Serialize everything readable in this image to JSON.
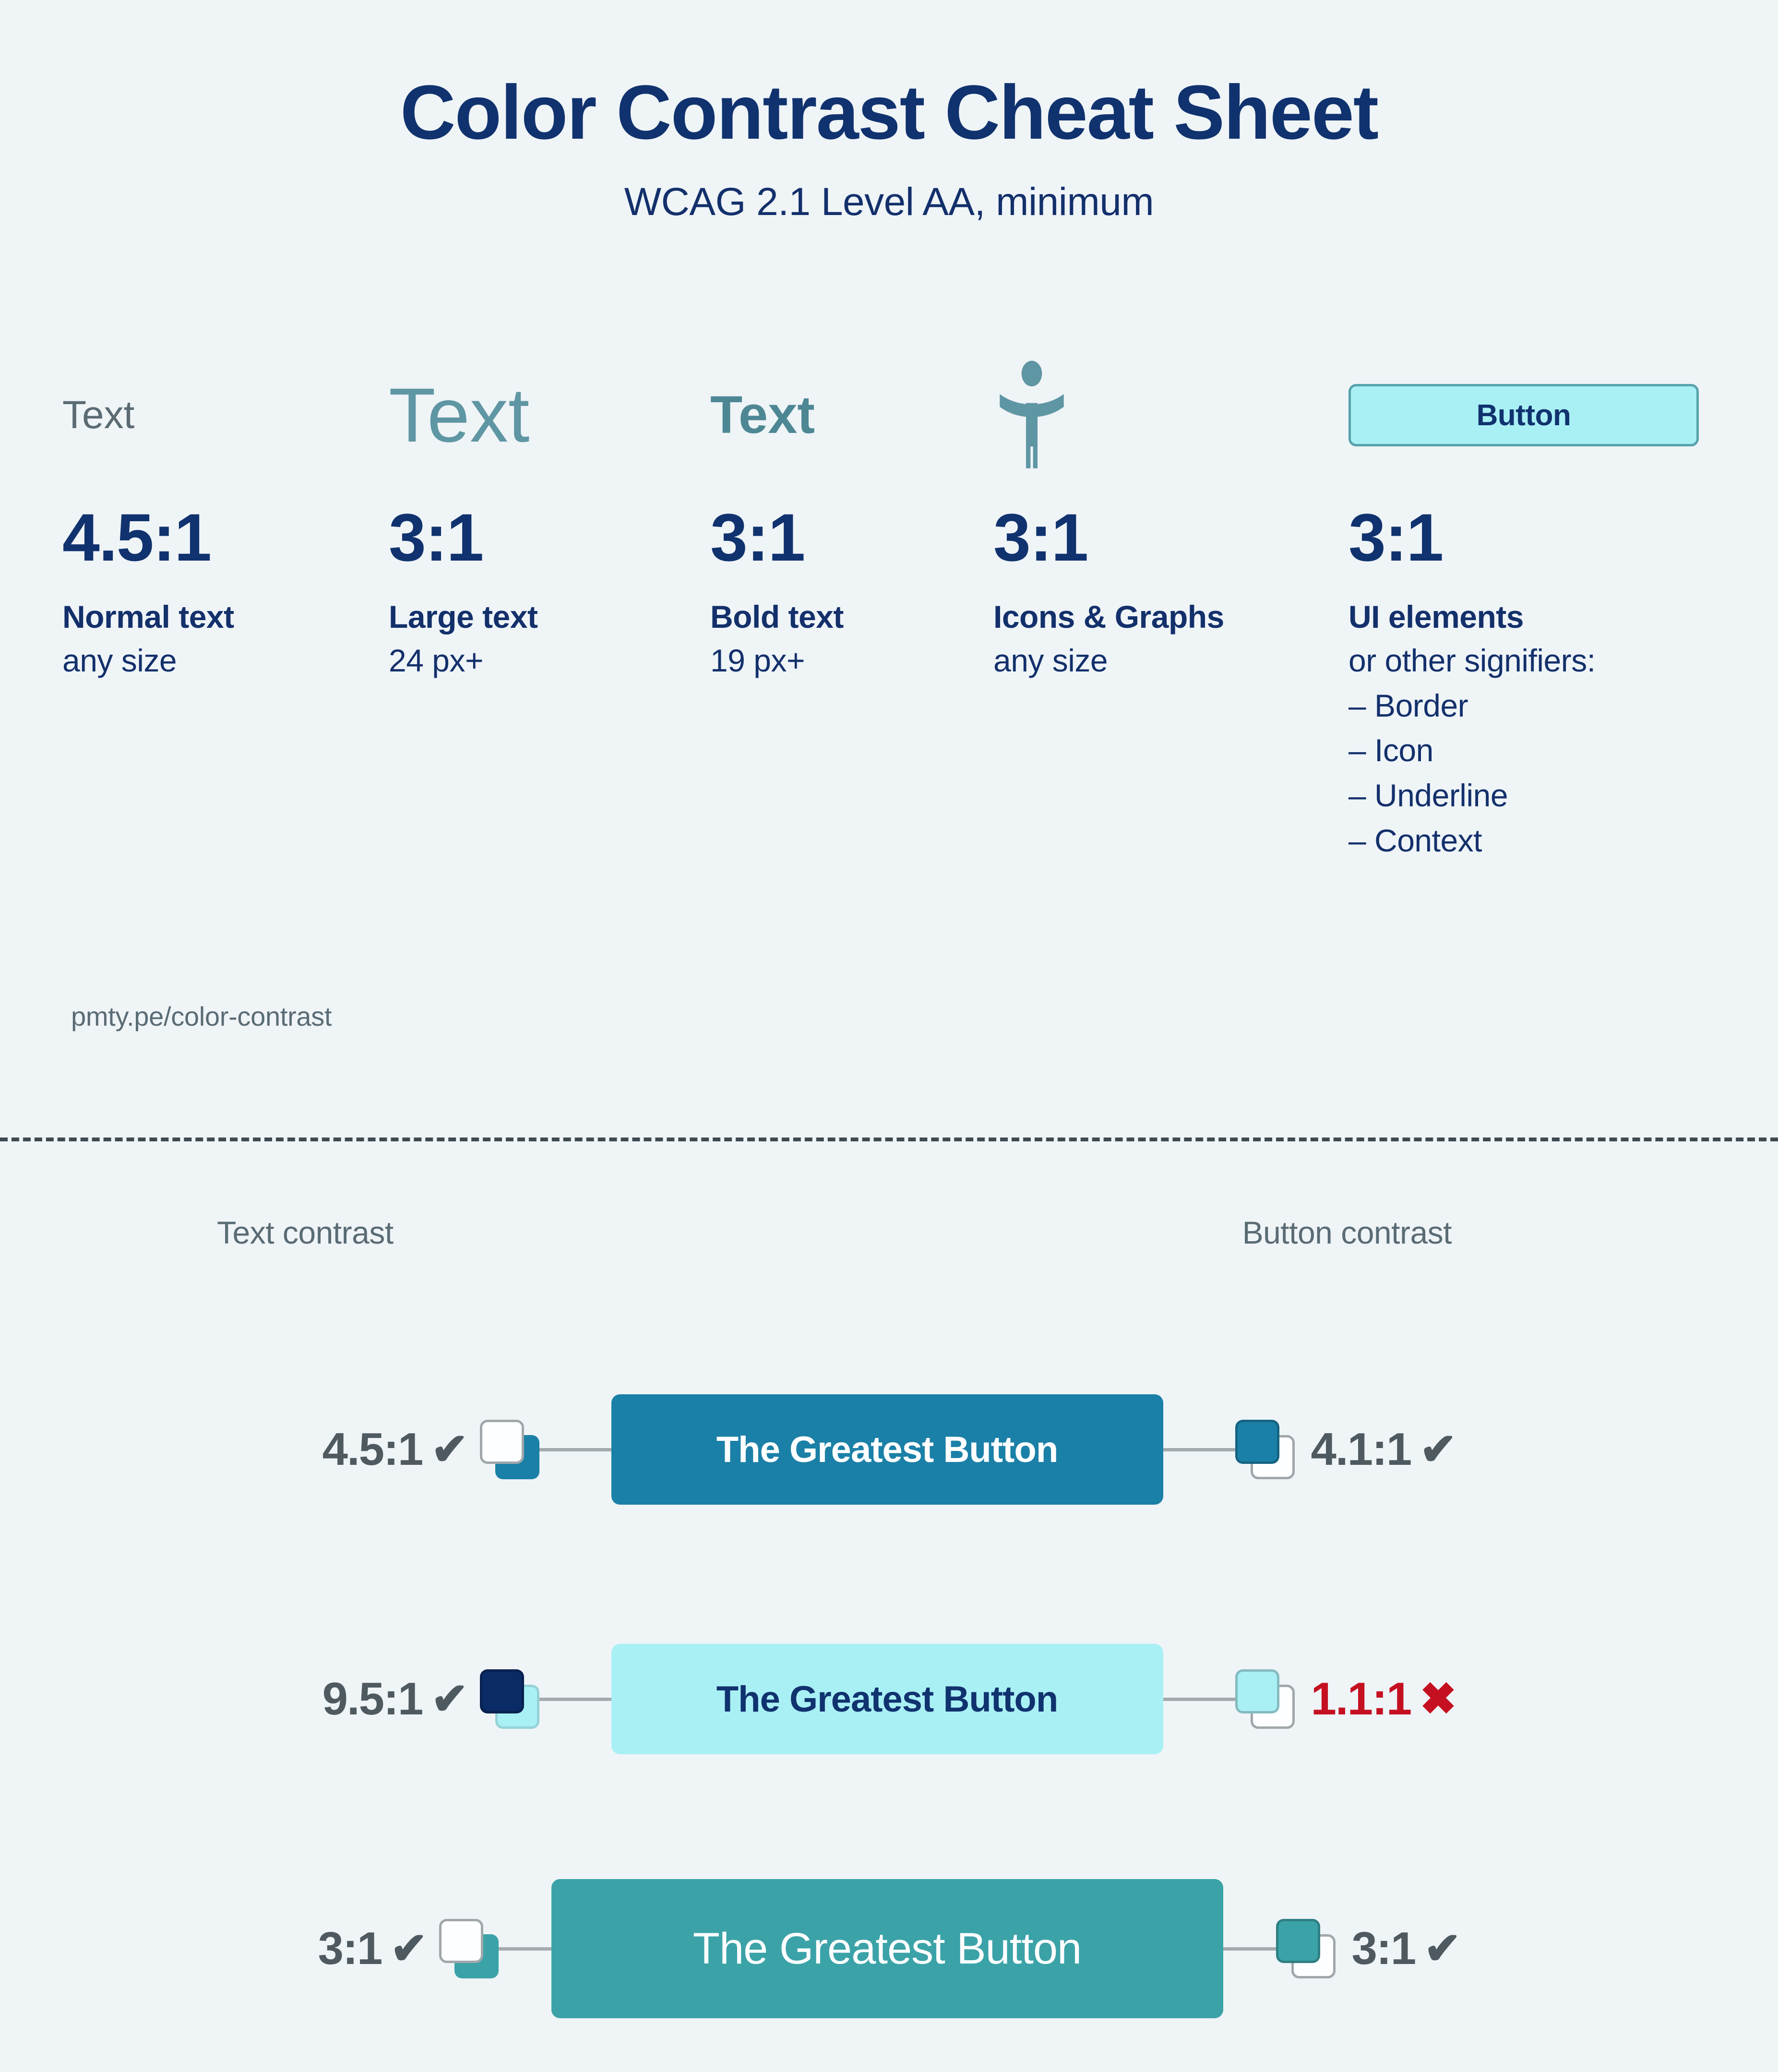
{
  "header": {
    "title": "Color Contrast Cheat Sheet",
    "subtitle": "WCAG 2.1 Level AA, minimum"
  },
  "colors": {
    "page_bg": "#eff4f7",
    "navy": "#10326e",
    "navy_dark": "#0d2e6b",
    "gray_text": "#5a6b74",
    "teal_dark": "#1b80a7",
    "teal_mid": "#3ba3a8",
    "cyan_light": "#a9f0f5",
    "red_fail": "#c41020",
    "swatch_border": "#a0a7ab",
    "connector": "#a3abaf",
    "divider": "#3f4a50"
  },
  "top_columns": [
    {
      "sample_text": "Text",
      "sample_kind": "normal-text-sample",
      "ratio": "4.5:1",
      "label": "Normal text",
      "sublabel": "any size"
    },
    {
      "sample_text": "Text",
      "sample_kind": "large-text-sample",
      "ratio": "3:1",
      "label": "Large text",
      "sublabel": "24 px+"
    },
    {
      "sample_text": "Text",
      "sample_kind": "bold-text-sample",
      "ratio": "3:1",
      "label": "Bold text",
      "sublabel": "19 px+"
    },
    {
      "sample_text": "",
      "sample_kind": "accessibility-icon",
      "ratio": "3:1",
      "label": "Icons & Graphs",
      "sublabel": "any size"
    },
    {
      "sample_text": "Button",
      "sample_kind": "button-sample",
      "ratio": "3:1",
      "label": "UI elements",
      "sublabel": "or other signifiers:",
      "bullets": [
        "– Border",
        "– Icon",
        "– Underline",
        "– Context"
      ]
    }
  ],
  "source_url": "pmty.pe/color-contrast",
  "bottom": {
    "left_heading": "Text contrast",
    "right_heading": "Button contrast",
    "rows": [
      {
        "text_ratio": "4.5:1",
        "text_mark": "✔",
        "text_pass": true,
        "text_swatch_front": "#fdfeff",
        "text_swatch_front_outline": true,
        "text_swatch_back": "#1b80a7",
        "button_label": "The Greatest Button",
        "button_bg": "#1b80a7",
        "button_fg": "#ffffff",
        "button_font_weight": "700",
        "button_font_size": "76",
        "button_width": "1150",
        "button_height": "230",
        "btn_ratio": "4.1:1",
        "btn_mark": "✔",
        "btn_pass": true,
        "btn_swatch_front": "#1b80a7",
        "btn_swatch_front_outline": false,
        "btn_swatch_back": "#fdfeff"
      },
      {
        "text_ratio": "9.5:1",
        "text_mark": "✔",
        "text_pass": true,
        "text_swatch_front": "#0b2b66",
        "text_swatch_front_outline": false,
        "text_swatch_back": "#a9f0f5",
        "button_label": "The Greatest Button",
        "button_bg": "#a9f0f5",
        "button_fg": "#10326e",
        "button_font_weight": "700",
        "button_font_size": "76",
        "button_width": "1150",
        "button_height": "230",
        "btn_ratio": "1.1:1",
        "btn_mark": "✖",
        "btn_pass": false,
        "btn_swatch_front": "#a9f0f5",
        "btn_swatch_front_outline": false,
        "btn_swatch_back": "#fdfeff"
      },
      {
        "text_ratio": "3:1",
        "text_mark": "✔",
        "text_pass": true,
        "text_swatch_front": "#fdfeff",
        "text_swatch_front_outline": true,
        "text_swatch_back": "#3ba3a8",
        "button_label": "The Greatest Button",
        "button_bg": "#3ba3a8",
        "button_fg": "#ffffff",
        "button_font_weight": "400",
        "button_font_size": "92",
        "button_width": "1400",
        "button_height": "290",
        "btn_ratio": "3:1",
        "btn_mark": "✔",
        "btn_pass": true,
        "btn_swatch_front": "#3ba3a8",
        "btn_swatch_front_outline": false,
        "btn_swatch_back": "#fdfeff"
      }
    ]
  }
}
